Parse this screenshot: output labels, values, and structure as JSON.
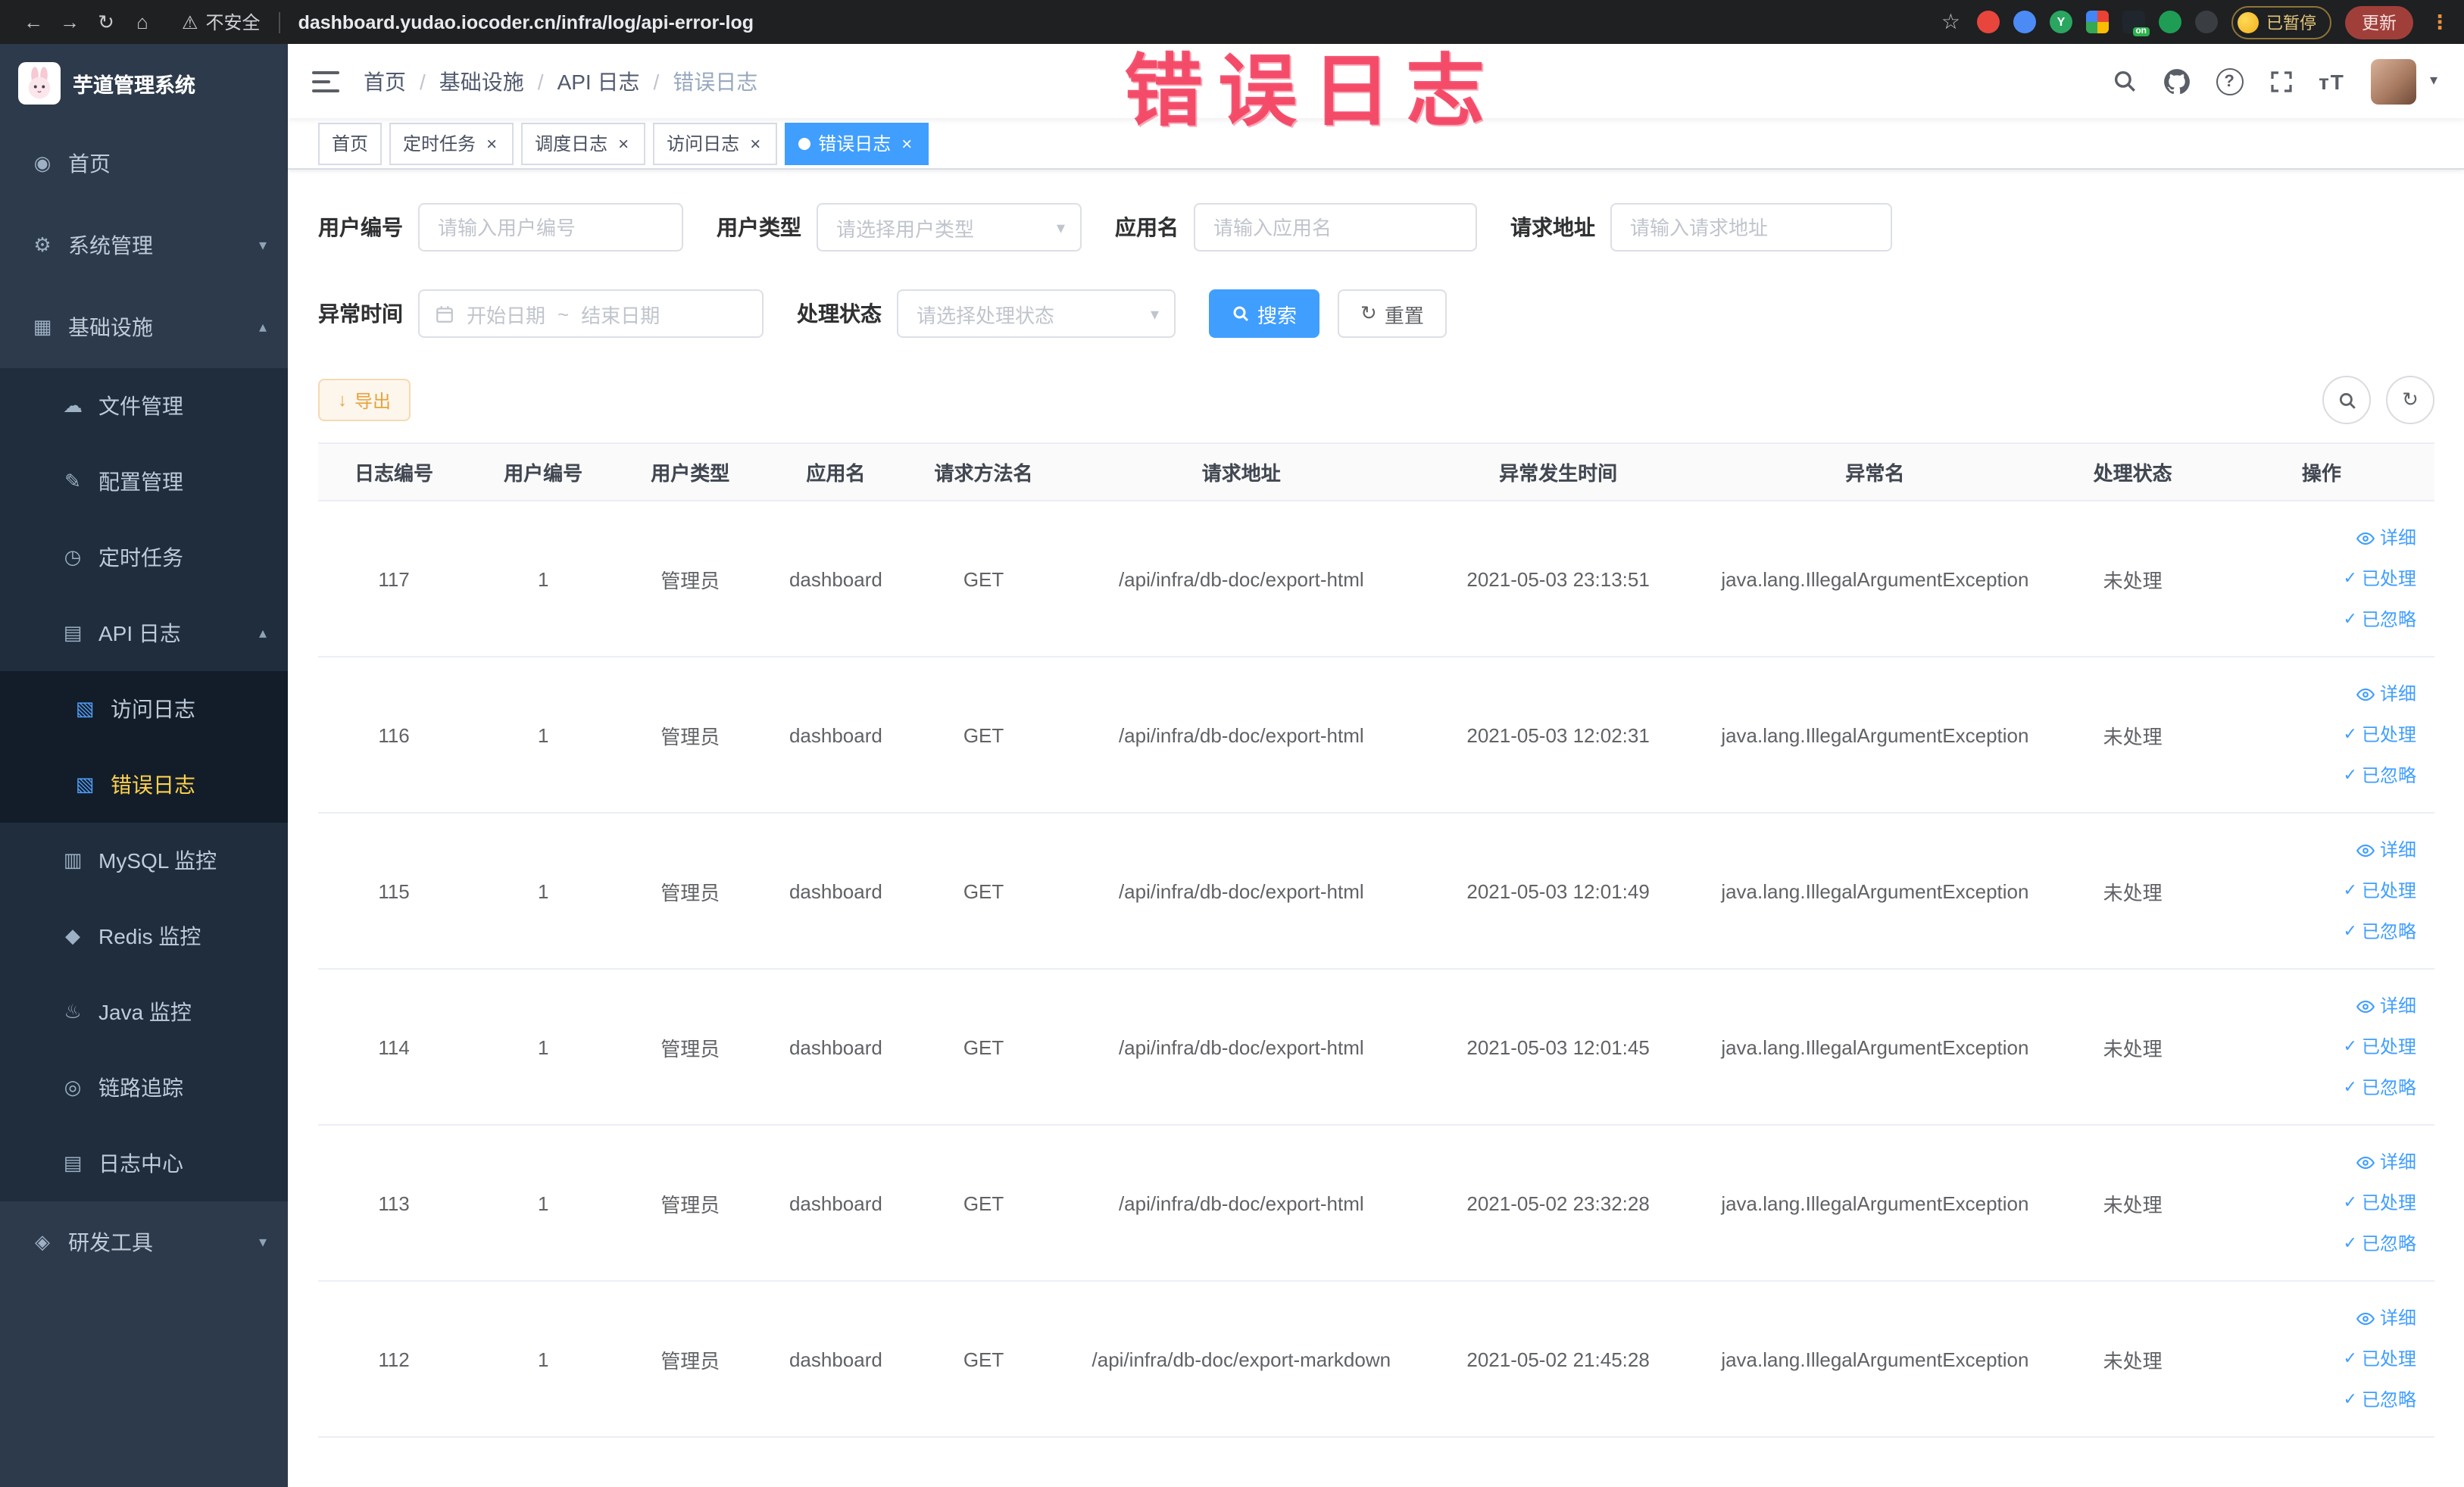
{
  "colors": {
    "accent": "#409eff",
    "active_tab_bg": "#409eff",
    "menu_active_text": "#ffd04b",
    "sidebar_bg": "#2d3a4b",
    "sidebar_submenu_bg": "#1f2d3d",
    "sidebar_nested_bg": "#121d29",
    "annotation": "#f23e5e",
    "export_button_text": "#e6a23c",
    "link": "#409eff"
  },
  "icons": {
    "back": "←",
    "forward": "→",
    "reload": "↻",
    "home": "⌂",
    "warning": "⚠",
    "star": "☆",
    "kebab": "⋮",
    "question": "?",
    "font_size": "тT",
    "caret_down": "▾",
    "refresh": "↻",
    "download": "↓",
    "check": "✓",
    "crumb_separator": "/"
  },
  "browser": {
    "security_label": "不安全",
    "url": "dashboard.yudao.iocoder.cn/infra/log/api-error-log",
    "paused_badge": "已暂停",
    "update_label": "更新"
  },
  "annotation": {
    "text": "错误日志"
  },
  "sidebar": {
    "logo_title": "芋道管理系统",
    "menu": [
      {
        "key": "home",
        "label": "首页",
        "icon": "home-icon",
        "glyph": "◉",
        "level": 0
      },
      {
        "key": "system",
        "label": "系统管理",
        "icon": "gear-icon",
        "glyph": "⚙",
        "level": 0,
        "chevron": "down"
      },
      {
        "key": "infra",
        "label": "基础设施",
        "icon": "grid-icon",
        "glyph": "▦",
        "level": 0,
        "chevron": "up"
      },
      {
        "key": "file",
        "label": "文件管理",
        "icon": "cloud-icon",
        "glyph": "☁",
        "level": 1
      },
      {
        "key": "config",
        "label": "配置管理",
        "icon": "edit-icon",
        "glyph": "✎",
        "level": 1
      },
      {
        "key": "job",
        "label": "定时任务",
        "icon": "clock-icon",
        "glyph": "◷",
        "level": 1
      },
      {
        "key": "api-log",
        "label": "API 日志",
        "icon": "document-icon",
        "glyph": "▤",
        "level": 1,
        "chevron": "up"
      },
      {
        "key": "access-log",
        "label": "访问日志",
        "icon": "doc-icon",
        "glyph": "▧",
        "level": 2,
        "icon_color": "#4e9ef7"
      },
      {
        "key": "error-log",
        "label": "错误日志",
        "icon": "doc-icon",
        "glyph": "▧",
        "level": 2,
        "icon_color": "#4e9ef7",
        "active": true
      },
      {
        "key": "mysql",
        "label": "MySQL 监控",
        "icon": "database-icon",
        "glyph": "▥",
        "level": 1
      },
      {
        "key": "redis",
        "label": "Redis 监控",
        "icon": "redis-icon",
        "glyph": "◆",
        "level": 1
      },
      {
        "key": "java",
        "label": "Java 监控",
        "icon": "java-icon",
        "glyph": "♨",
        "level": 1
      },
      {
        "key": "tracing",
        "label": "链路追踪",
        "icon": "trace-icon",
        "glyph": "◎",
        "level": 1
      },
      {
        "key": "log-center",
        "label": "日志中心",
        "icon": "log-icon",
        "glyph": "▤",
        "level": 1
      },
      {
        "key": "devtools",
        "label": "研发工具",
        "icon": "tools-icon",
        "glyph": "◈",
        "level": 0,
        "chevron": "down"
      }
    ]
  },
  "header": {
    "breadcrumb": [
      "首页",
      "基础设施",
      "API 日志",
      "错误日志"
    ]
  },
  "tabs": [
    {
      "key": "home",
      "label": "首页",
      "closable": false,
      "active": false
    },
    {
      "key": "job",
      "label": "定时任务",
      "closable": true,
      "active": false
    },
    {
      "key": "job-log",
      "label": "调度日志",
      "closable": true,
      "active": false
    },
    {
      "key": "access-log",
      "label": "访问日志",
      "closable": true,
      "active": false
    },
    {
      "key": "error-log",
      "label": "错误日志",
      "closable": true,
      "active": true
    }
  ],
  "filters": {
    "user_id": {
      "label": "用户编号",
      "placeholder": "请输入用户编号"
    },
    "user_type": {
      "label": "用户类型",
      "placeholder": "请选择用户类型"
    },
    "app_name": {
      "label": "应用名",
      "placeholder": "请输入应用名"
    },
    "request_url": {
      "label": "请求地址",
      "placeholder": "请输入请求地址"
    },
    "exception_time": {
      "label": "异常时间",
      "start_placeholder": "开始日期",
      "separator": "~",
      "end_placeholder": "结束日期"
    },
    "process_status": {
      "label": "处理状态",
      "placeholder": "请选择处理状态"
    },
    "search_label": "搜索",
    "reset_label": "重置"
  },
  "toolbar": {
    "export_label": "导出"
  },
  "table": {
    "columns": [
      "日志编号",
      "用户编号",
      "用户类型",
      "应用名",
      "请求方法名",
      "请求地址",
      "异常发生时间",
      "异常名",
      "处理状态",
      "操作"
    ],
    "action_labels": [
      "详细",
      "已处理",
      "已忽略"
    ],
    "rows": [
      {
        "id": "117",
        "user_id": "1",
        "user_type": "管理员",
        "app": "dashboard",
        "method": "GET",
        "url": "/api/infra/db-doc/export-html",
        "time": "2021-05-03 23:13:51",
        "exception": "java.lang.IllegalArgumentException",
        "status": "未处理"
      },
      {
        "id": "116",
        "user_id": "1",
        "user_type": "管理员",
        "app": "dashboard",
        "method": "GET",
        "url": "/api/infra/db-doc/export-html",
        "time": "2021-05-03 12:02:31",
        "exception": "java.lang.IllegalArgumentException",
        "status": "未处理"
      },
      {
        "id": "115",
        "user_id": "1",
        "user_type": "管理员",
        "app": "dashboard",
        "method": "GET",
        "url": "/api/infra/db-doc/export-html",
        "time": "2021-05-03 12:01:49",
        "exception": "java.lang.IllegalArgumentException",
        "status": "未处理"
      },
      {
        "id": "114",
        "user_id": "1",
        "user_type": "管理员",
        "app": "dashboard",
        "method": "GET",
        "url": "/api/infra/db-doc/export-html",
        "time": "2021-05-03 12:01:45",
        "exception": "java.lang.IllegalArgumentException",
        "status": "未处理"
      },
      {
        "id": "113",
        "user_id": "1",
        "user_type": "管理员",
        "app": "dashboard",
        "method": "GET",
        "url": "/api/infra/db-doc/export-html",
        "time": "2021-05-02 23:32:28",
        "exception": "java.lang.IllegalArgumentException",
        "status": "未处理"
      },
      {
        "id": "112",
        "user_id": "1",
        "user_type": "管理员",
        "app": "dashboard",
        "method": "GET",
        "url": "/api/infra/db-doc/export-markdown",
        "time": "2021-05-02 21:45:28",
        "exception": "java.lang.IllegalArgumentException",
        "status": "未处理"
      }
    ]
  }
}
